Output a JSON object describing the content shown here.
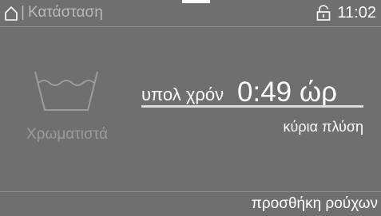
{
  "header": {
    "home_icon": "home-icon",
    "separator": "|",
    "title": "Κατάσταση",
    "lock_icon": "lock-icon",
    "time": "11:02"
  },
  "program": {
    "icon": "wash-tub-icon",
    "name": "Χρωματιστά"
  },
  "status": {
    "remaining_label": "υπολ χρόν",
    "remaining_value": "0:49 ώρ",
    "progress_percent": 100,
    "phase": "κύρια πλύση"
  },
  "footer": {
    "add_laundry_label": "προσθήκη ρούχων"
  },
  "colors": {
    "background": "#6f6f6f",
    "text": "#ffffff",
    "muted_text": "#9c9c9c",
    "divider": "#8f8f8f"
  }
}
